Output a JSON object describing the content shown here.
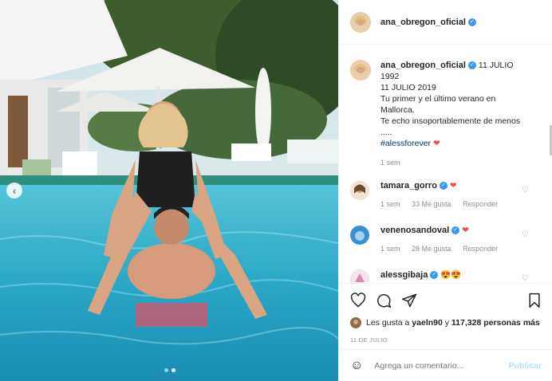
{
  "post": {
    "username": "ana_obregon_oficial",
    "verified_icon": "verified-badge-icon",
    "photo_description_icon": "pool-photo"
  },
  "caption": {
    "username": "ana_obregon_oficial",
    "text_first": "11 JULIO",
    "lines": [
      "1992",
      "11 JULIO 2019",
      "Tu primer y el último verano en",
      "Mallorca.",
      "Te echo insoportablemente de menos",
      "....."
    ],
    "hashtag": "#alessforever",
    "heart": "❤",
    "time": "1 sem"
  },
  "comments": [
    {
      "username": "tamara_gorro",
      "text": "❤",
      "time": "1 sem",
      "likes": "33 Me gusta",
      "reply": "Responder"
    },
    {
      "username": "venenosandoval",
      "text": "❤",
      "time": "1 sem",
      "likes": "28 Me gusta",
      "reply": "Responder"
    },
    {
      "username": "alessgibaja",
      "text": "😍😍",
      "time": "",
      "likes": "",
      "reply": ""
    }
  ],
  "likes_line": {
    "prefix": "Les gusta a ",
    "user": "yaeln90",
    "middle": " y ",
    "count": "117,328 personas más"
  },
  "date": "11 DE JULIO",
  "add_comment": {
    "placeholder": "Agrega un comentario...",
    "publish": "Publicar"
  },
  "colors": {
    "accent": "#3897f0",
    "like_red": "#ed4956",
    "publish_disabled": "#b2dffc"
  }
}
